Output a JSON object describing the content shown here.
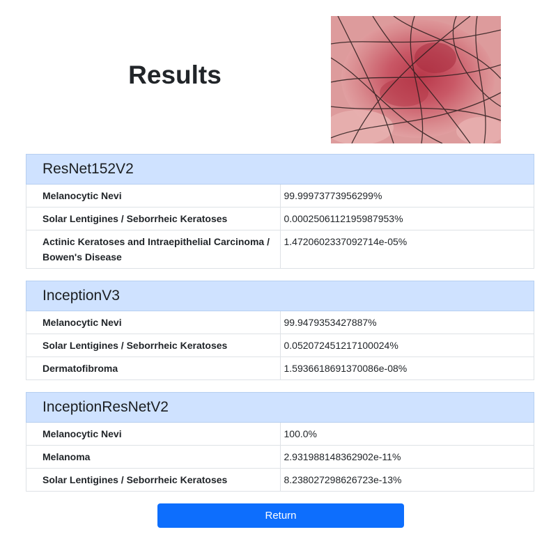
{
  "page": {
    "title": "Results",
    "return_label": "Return"
  },
  "models": [
    {
      "name": "ResNet152V2",
      "rows": [
        {
          "label": "Melanocytic Nevi",
          "value": "99.99973773956299%"
        },
        {
          "label": "Solar Lentigines / Seborrheic Keratoses",
          "value": "0.0002506112195987953%"
        },
        {
          "label": "Actinic Keratoses and Intraepithelial Carcinoma / Bowen's Disease",
          "value": "1.4720602337092714e-05%"
        }
      ]
    },
    {
      "name": "InceptionV3",
      "rows": [
        {
          "label": "Melanocytic Nevi",
          "value": "99.9479353427887%"
        },
        {
          "label": "Solar Lentigines / Seborrheic Keratoses",
          "value": "0.052072451217100024%"
        },
        {
          "label": "Dermatofibroma",
          "value": "1.5936618691370086e-08%"
        }
      ]
    },
    {
      "name": "InceptionResNetV2",
      "rows": [
        {
          "label": "Melanocytic Nevi",
          "value": "100.0%"
        },
        {
          "label": "Melanoma",
          "value": "2.931988148362902e-11%"
        },
        {
          "label": "Solar Lentigines / Seborrheic Keratoses",
          "value": "8.238027298626723e-13%"
        }
      ]
    }
  ],
  "colors": {
    "table_header_bg": "#cfe2ff",
    "button_bg": "#0d6efd",
    "button_text": "#ffffff"
  }
}
